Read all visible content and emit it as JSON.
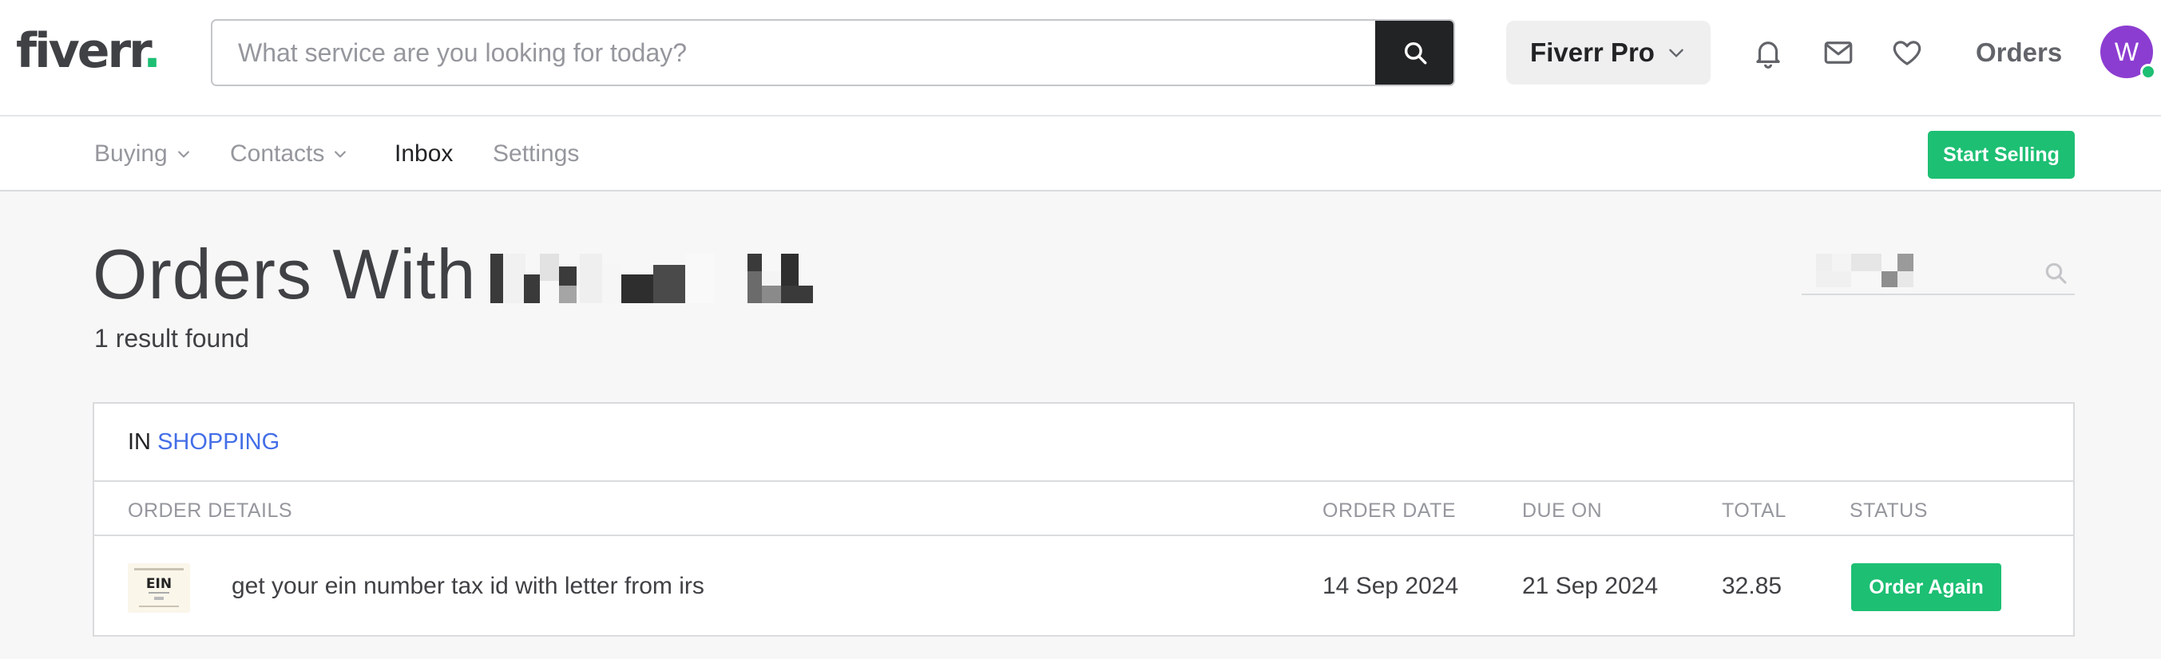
{
  "header": {
    "logo_text": "fiverr",
    "logo_dot": ".",
    "search_placeholder": "What service are you looking for today?",
    "pro_label": "Fiverr Pro",
    "orders_label": "Orders",
    "avatar_initial": "W",
    "icons": [
      "search-icon",
      "bell-icon",
      "mail-icon",
      "heart-icon"
    ]
  },
  "subnav": {
    "items": [
      {
        "label": "Buying",
        "has_dropdown": true
      },
      {
        "label": "Contacts",
        "has_dropdown": true
      },
      {
        "label": "Inbox",
        "has_dropdown": false,
        "active": true
      },
      {
        "label": "Settings",
        "has_dropdown": false
      }
    ],
    "start_selling_label": "Start Selling"
  },
  "page": {
    "title": "Orders With",
    "result_count": "1 result found"
  },
  "table": {
    "in_label": "IN",
    "category": "SHOPPING",
    "columns": [
      "ORDER DETAILS",
      "ORDER DATE",
      "DUE ON",
      "TOTAL",
      "STATUS"
    ],
    "rows": [
      {
        "thumbnail_text": "EIN",
        "details": "get your ein number tax id with letter from irs",
        "order_date": "14 Sep 2024",
        "due_on": "21 Sep 2024",
        "total": "32.85",
        "status_button": "Order Again"
      }
    ]
  },
  "colors": {
    "brand_green": "#1dbf73",
    "link_blue": "#446ee7",
    "avatar_purple": "#8c3dd1",
    "dark": "#222325"
  }
}
